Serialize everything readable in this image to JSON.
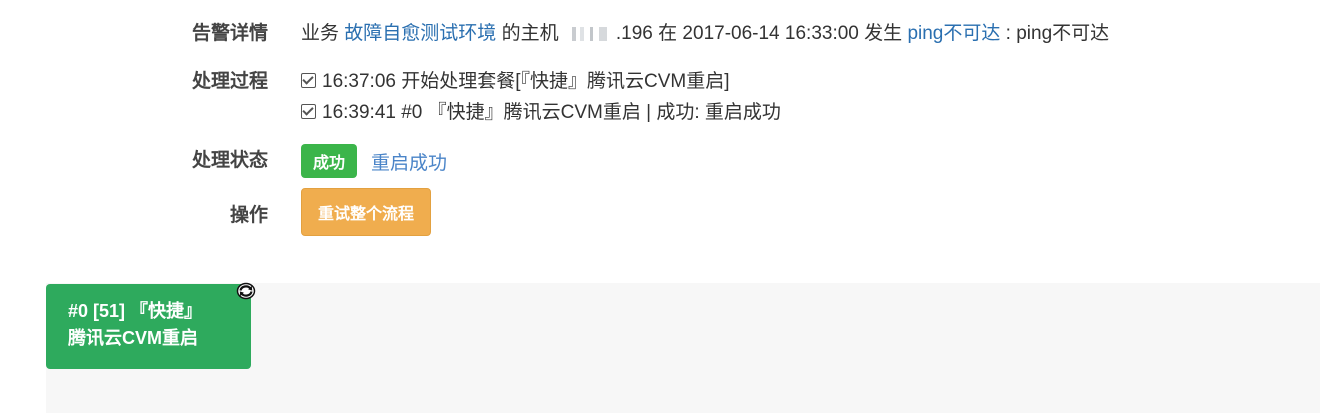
{
  "alert": {
    "label": "告警详情",
    "prefix": "业务",
    "business_link": "故障自愈测试环境",
    "host_prefix": "的主机",
    "ip_suffix": ".196",
    "time_text": "在 2017-06-14 16:33:00 发生",
    "alarm_link": "ping不可达",
    "alarm_desc": ": ping不可达"
  },
  "process": {
    "label": "处理过程",
    "steps": [
      {
        "text": "16:37:06 开始处理套餐[『快捷』腾讯云CVM重启]"
      },
      {
        "text": "16:39:41 #0 『快捷』腾讯云CVM重启 | 成功: 重启成功"
      }
    ]
  },
  "status": {
    "label": "处理状态",
    "badge": "成功",
    "text": "重启成功",
    "badge_color": "#3bb54a",
    "text_color": "#4a84c8"
  },
  "actions": {
    "label": "操作",
    "retry_button": "重试整个流程",
    "retry_color": "#f0ad4e"
  },
  "flow": {
    "node": {
      "line1": "#0 [51] 『快捷』",
      "line2": "腾讯云CVM重启",
      "color": "#2eaa5d",
      "icon": "refresh-icon"
    }
  }
}
